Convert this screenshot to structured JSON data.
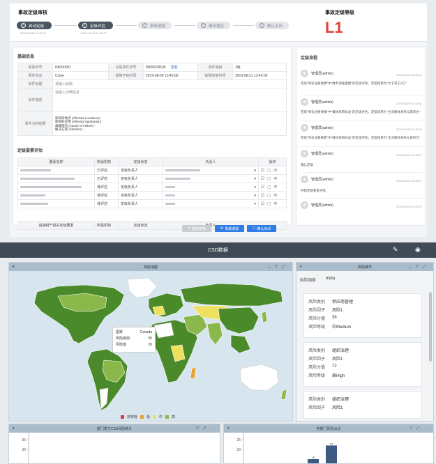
{
  "header": {
    "title": "事故定级审核",
    "level_title": "事故定级等级",
    "level": "L1"
  },
  "steps": [
    {
      "label": "启动定级",
      "time": "2019-08-09 11:40:27",
      "state": "done",
      "mark": "✓"
    },
    {
      "label": "定级评估",
      "time": "2019-08-09 11:40:27",
      "state": "done",
      "mark": "✓"
    },
    {
      "label": "事故通报",
      "time": "",
      "state": "todo",
      "mark": "✓"
    },
    {
      "label": "输出报告",
      "time": "",
      "state": "todo",
      "mark": "✓"
    },
    {
      "label": "确认关闭",
      "time": "",
      "state": "todo",
      "mark": "✓"
    }
  ],
  "basic": {
    "title": "基础信息",
    "lab_no": "事故单号",
    "no": "INI000001",
    "lab_case": "关联事件单号",
    "case": "INI00029536",
    "view": "查看",
    "lab_level": "事件等级",
    "level": "2级",
    "lab_state": "事件状态",
    "state": "Close",
    "lab_start": "故障开始时间",
    "start": "2019-08-09 13:40:00",
    "lab_recover": "故障恢复时间",
    "recover": "2019-08-21 13:40:00",
    "lab_title": "事件标题",
    "title_ph": "请输入标题",
    "lab_desc": "事件描述",
    "desc_ph": "请输入详细信息",
    "lab_analysis": "事件分析结果",
    "analysis": [
      "影响的地点 (Affected Locations) :",
      "影响的应用 (Affected Application) :",
      "故障原因 (Cause of Failure) :",
      "解决方案 (Solution) :"
    ]
  },
  "eval": {
    "title": "定级要素评估",
    "cols": [
      "要素名称",
      "所属机构",
      "定级状态",
      "负责人",
      "操作"
    ],
    "rows": [
      {
        "state": "已评估",
        "owner": "定级负责人"
      },
      {
        "state": "已评估",
        "owner": "定级负责人"
      },
      {
        "state": "待评估",
        "owner": "定级负责人"
      },
      {
        "state": "待评估",
        "owner": "定级负责人"
      },
      {
        "state": "待评估",
        "owner": "定级负责人"
      }
    ],
    "ops": "☑ ▢ ✉",
    "footer": [
      "直接财产损失定级要素",
      "所属机构",
      "定级状态",
      "负责人"
    ]
  },
  "process": {
    "title": "定级流程",
    "logs": [
      {
        "name": "管理员(admin)",
        "time": "2019-08-09 11:40:41",
        "text": "完成\"商标注册要素\"中\"财务调账金额\"的定级评估，定级结果为\"大于等于1亿\""
      },
      {
        "name": "管理员(admin)",
        "time": "2019-08-09 11:40:41",
        "text": "完成\"商标注册要素\"中\"媒体采购标准\"的定级评估，定级结果为\"主流媒体发布＆影响力\""
      },
      {
        "name": "管理员(admin)",
        "time": "2019-08-09 11:40:34",
        "text": "完成\"商标注册要素\"中\"媒体采购标准\"的定级评估，定级结果为\"主流媒体发布＆影响力\""
      },
      {
        "name": "管理员(admin)",
        "time": "2019-08-09 11:40:27",
        "text": "确认定级"
      },
      {
        "name": "管理员(admin)",
        "time": "2019-08-09 11:40:27",
        "text": "开始定级要素评估"
      },
      {
        "name": "管理员(admin)",
        "time": "2019-08-09 11:40:27",
        "text": ""
      }
    ]
  },
  "actions": {
    "reset": "重新定级",
    "notify": "事故通报",
    "close": "确认关闭"
  },
  "csd": {
    "title": "CSD数据",
    "map_title": "风险地图",
    "tooltip": {
      "k1": "国家",
      "v1": "Canada",
      "k2": "风险级别",
      "v2": "55",
      "k3": "风险值",
      "v3": "20"
    },
    "legend": [
      "非常低",
      "低",
      "中",
      "高"
    ],
    "legend_colors": [
      "#d93a3a",
      "#e8a030",
      "#f0e060",
      "#8bb84a",
      "#4a8a2a"
    ],
    "detail_title": "风险细节",
    "country_label": "当前国家",
    "country": "India",
    "details": [
      {
        "k1": "风险类别",
        "v1": "供应商管理",
        "k2": "风险因子",
        "v2": "风险1",
        "k3": "风险分值",
        "v3": "36",
        "k4": "风险等级",
        "v4": "中Medium"
      },
      {
        "k1": "风险类别",
        "v1": "组织治理",
        "k2": "风险因子",
        "v2": "风险1",
        "k3": "风险分值",
        "v3": "72",
        "k4": "风险等级",
        "v4": "高High"
      },
      {
        "k1": "风险类别",
        "v1": "组织治理",
        "k2": "风险因子",
        "v2": "风险1",
        "k3": "",
        "v3": "",
        "k4": "",
        "v4": ""
      }
    ],
    "chart1_title": "部门发生CSD风险统计",
    "chart2_title": "各部门风险占比"
  },
  "chart_data": [
    {
      "type": "bar",
      "title": "部门发生CSD风险统计",
      "yticks": [
        35,
        30
      ],
      "values": [
        2,
        16
      ],
      "labels": [
        "",
        "16"
      ],
      "color": "#d93a3a"
    },
    {
      "type": "bar",
      "title": "各部门风险占比",
      "yticks": [
        25,
        20
      ],
      "values": [
        15,
        22
      ],
      "labels": [
        "15",
        "22"
      ],
      "color": "#3d5a80"
    }
  ]
}
